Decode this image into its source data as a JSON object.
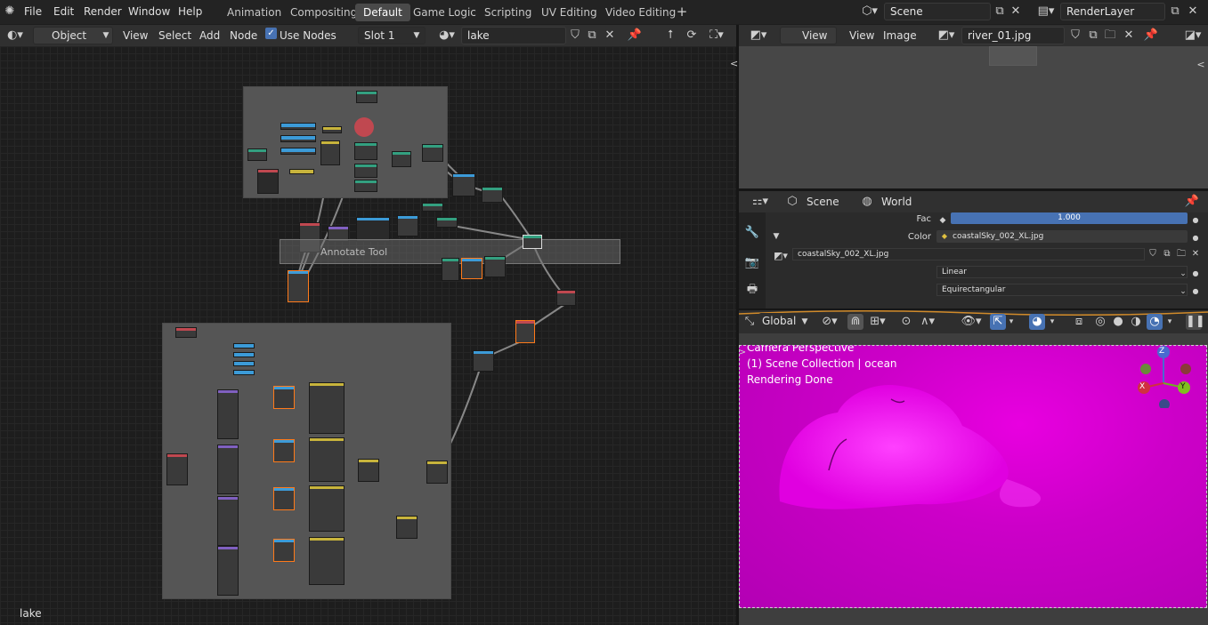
{
  "topbar": {
    "menus": [
      "File",
      "Edit",
      "Render",
      "Window",
      "Help"
    ],
    "workspaces": [
      "Animation",
      "Compositing",
      "Default",
      "Game Logic",
      "Scripting",
      "UV Editing",
      "Video Editing"
    ],
    "active_workspace": "Default",
    "add_tab_label": "+",
    "scene_name": "Scene",
    "render_layer": "RenderLayer"
  },
  "node_editor": {
    "object_mode": "Object",
    "menus": [
      "View",
      "Select",
      "Add",
      "Node"
    ],
    "use_nodes_label": "Use Nodes",
    "use_nodes_checked": true,
    "slot": "Slot 1",
    "material_name": "lake",
    "floating_label": "Annotate Tool",
    "footer_label": "lake"
  },
  "image_editor": {
    "view_label": "View",
    "menus": [
      "View",
      "Image"
    ],
    "image_name": "river_01.jpg"
  },
  "properties": {
    "tabs": [
      "Scene",
      "World"
    ],
    "fac_label": "Fac",
    "fac_value": "1.000",
    "color_label": "Color",
    "color_value": "coastalSky_002_XL.jpg",
    "image_name": "coastalSky_002_XL.jpg",
    "interpolation": "Linear",
    "projection": "Equirectangular",
    "accent_color": "#4772b3"
  },
  "viewport": {
    "orientation": "Global",
    "overlay_lines": [
      "Camera Perspective",
      "(1) Scene Collection | ocean",
      "Rendering Done"
    ],
    "gizmo_axes": [
      "Z",
      "X",
      "Y"
    ],
    "render_color": "#cc00c8"
  }
}
